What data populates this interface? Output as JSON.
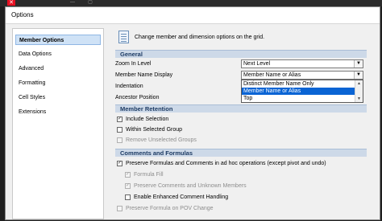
{
  "window_controls": {
    "close": "✕",
    "minimize": "—",
    "maximize": "▢"
  },
  "dialog": {
    "title": "Options"
  },
  "sidebar": {
    "items": [
      {
        "label": "Member Options",
        "selected": true
      },
      {
        "label": "Data Options"
      },
      {
        "label": "Advanced"
      },
      {
        "label": "Formatting"
      },
      {
        "label": "Cell Styles"
      },
      {
        "label": "Extensions"
      }
    ]
  },
  "content": {
    "description": "Change member and dimension options on the grid.",
    "general": {
      "title": "General",
      "zoom_label": "Zoom In Level",
      "zoom_value": "Next Level",
      "member_name_label": "Member Name Display",
      "member_name_value": "Member Name or Alias",
      "indentation_label": "Indentation",
      "ancestor_label": "Ancestor Position",
      "dropdown_options": [
        "Distinct Member Name Only",
        "Member Name or Alias",
        "Top"
      ]
    },
    "retention": {
      "title": "Member Retention",
      "include_selection": "Include Selection",
      "within_group": "Within Selected Group",
      "remove_unselected": "Remove Unselected Groups"
    },
    "comments": {
      "title": "Comments and Formulas",
      "preserve_formulas": "Preserve Formulas and Comments in ad hoc operations (except pivot and undo)",
      "formula_fill": "Formula Fill",
      "preserve_comments": "Preserve Comments and Unknown Members",
      "enable_comment": "Enable Enhanced Comment Handling",
      "preserve_pov": "Preserve Formula on POV Change"
    }
  },
  "colors": {
    "accent": "#0a64d4",
    "section_bg": "#cdd9e8",
    "selected_item": "#cfe2f6"
  }
}
